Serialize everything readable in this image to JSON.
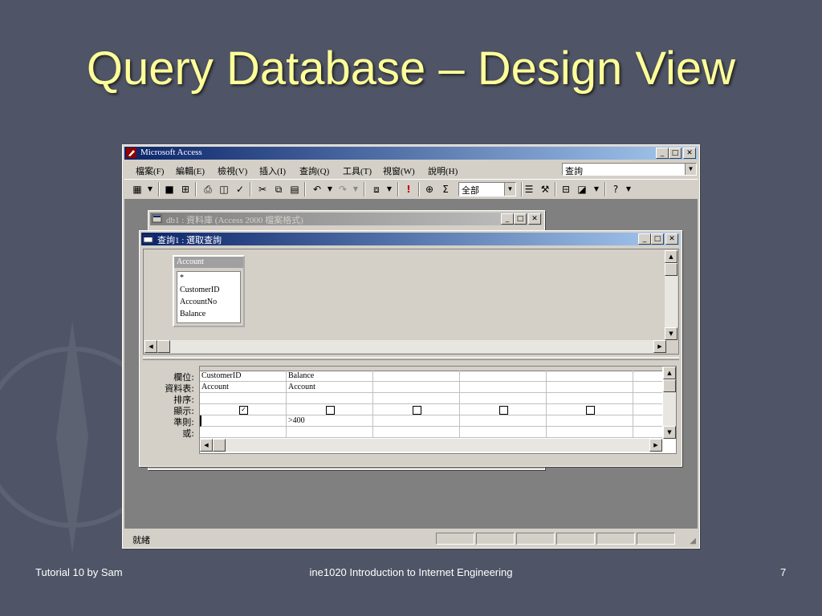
{
  "slide": {
    "title": "Query Database – Design View",
    "footer_left": "Tutorial 10 by Sam",
    "footer_center": "ine1020 Introduction to Internet Engineering",
    "footer_right": "7"
  },
  "access": {
    "title": "Microsoft Access",
    "menu": [
      "檔案(F)",
      "編輯(E)",
      "檢視(V)",
      "插入(I)",
      "查詢(Q)",
      "工具(T)",
      "視窗(W)",
      "說明(H)"
    ],
    "help_box_value": "查詢",
    "toolbar_combo_value": "全部",
    "status_text": "就緒"
  },
  "db_window": {
    "title": "db1 : 資料庫 (Access 2000 檔案格式)"
  },
  "query_window": {
    "title": "查詢1 : 選取查詢",
    "table": {
      "name": "Account",
      "fields": [
        "*",
        "CustomerID",
        "AccountNo",
        "Balance"
      ]
    },
    "row_labels": [
      "欄位:",
      "資料表:",
      "排序:",
      "顯示:",
      "準則:",
      "或:"
    ],
    "columns": [
      {
        "field": "CustomerID",
        "table": "Account",
        "sort": "",
        "show": true,
        "criteria": "",
        "or": ""
      },
      {
        "field": "Balance",
        "table": "Account",
        "sort": "",
        "show": false,
        "criteria": ">400",
        "or": ""
      },
      {
        "field": "",
        "table": "",
        "sort": "",
        "show": false,
        "criteria": "",
        "or": ""
      },
      {
        "field": "",
        "table": "",
        "sort": "",
        "show": false,
        "criteria": "",
        "or": ""
      },
      {
        "field": "",
        "table": "",
        "sort": "",
        "show": false,
        "criteria": "",
        "or": ""
      }
    ]
  }
}
